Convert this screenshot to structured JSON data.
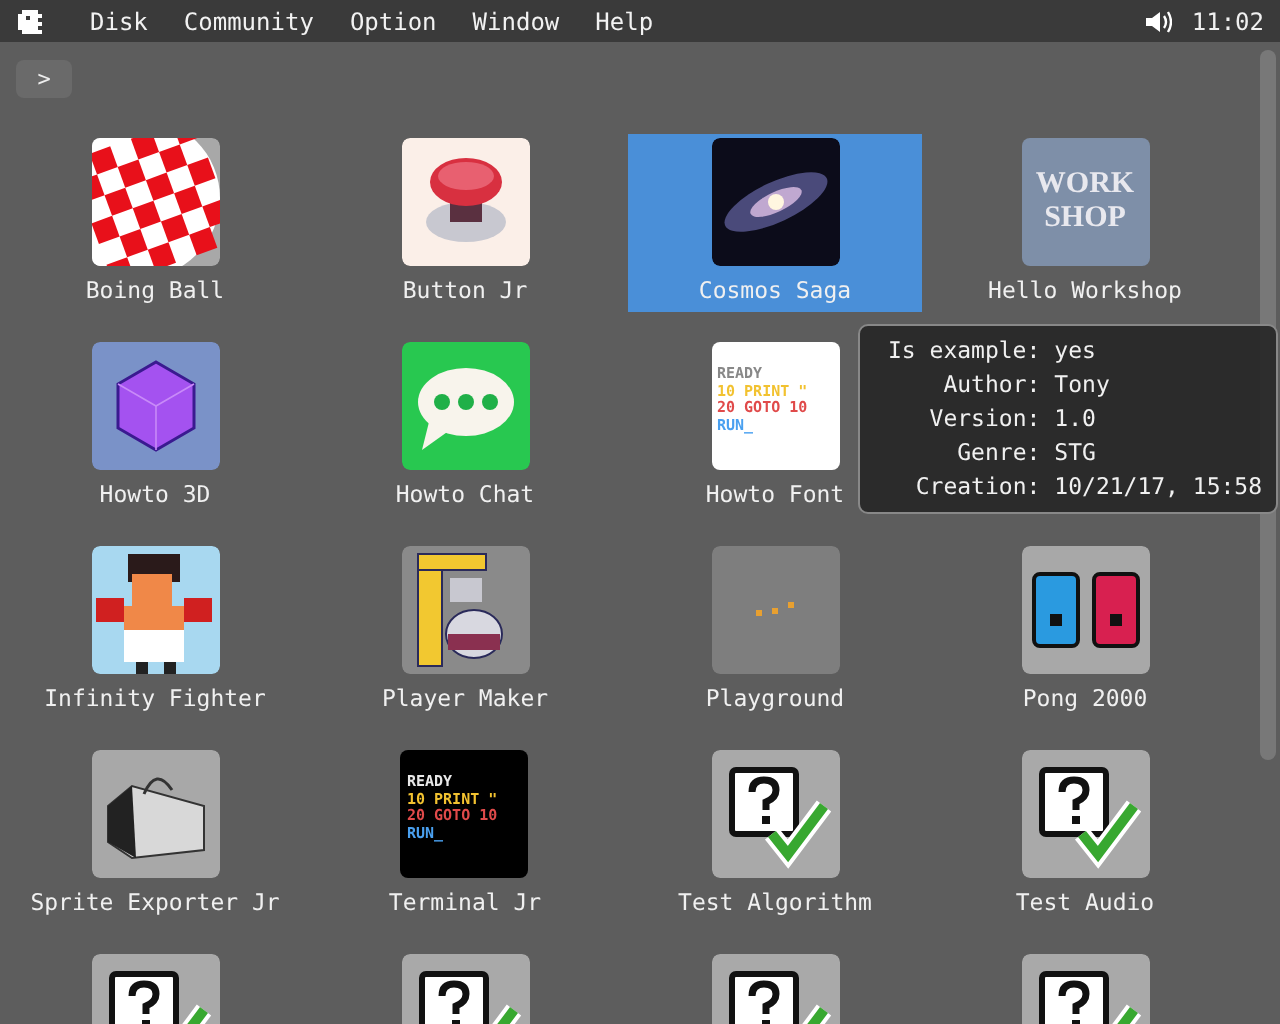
{
  "menu_bar": {
    "items": [
      "Disk",
      "Community",
      "Option",
      "Window",
      "Help"
    ],
    "clock": "11:02"
  },
  "breadcrumb": {
    "label": ">"
  },
  "programs": [
    {
      "label": "Boing Ball",
      "kind": "ball",
      "selected": false
    },
    {
      "label": "Button Jr",
      "kind": "button",
      "selected": false
    },
    {
      "label": "Cosmos Saga",
      "kind": "galaxy",
      "selected": true
    },
    {
      "label": "Hello Workshop",
      "kind": "workshop",
      "icon_text": [
        "WORK",
        "SHOP"
      ],
      "selected": false
    },
    {
      "label": "Howto 3D",
      "kind": "cube",
      "selected": false
    },
    {
      "label": "Howto Chat",
      "kind": "chat",
      "selected": false
    },
    {
      "label": "Howto Font",
      "kind": "code",
      "icon_text": [
        "READY",
        "10 PRINT \"",
        "20 GOTO 10",
        "RUN_"
      ],
      "selected": false
    },
    {
      "kind": "hidden"
    },
    {
      "label": "Infinity Fighter",
      "kind": "fighter",
      "selected": false
    },
    {
      "label": "Player Maker",
      "kind": "coffee",
      "selected": false
    },
    {
      "label": "Playground",
      "kind": "playground",
      "selected": false
    },
    {
      "label": "Pong 2000",
      "kind": "pong",
      "selected": false
    },
    {
      "label": "Sprite Exporter Jr",
      "kind": "toolbox",
      "selected": false
    },
    {
      "label": "Terminal Jr",
      "kind": "terminal",
      "icon_text": [
        "READY",
        "10 PRINT \"",
        "20 GOTO 10",
        "RUN_"
      ],
      "selected": false
    },
    {
      "label": "Test Algorithm",
      "kind": "test",
      "selected": false
    },
    {
      "label": "Test Audio",
      "kind": "test",
      "selected": false
    },
    {
      "kind": "test",
      "selected": false
    },
    {
      "kind": "test",
      "selected": false
    },
    {
      "kind": "test",
      "selected": false
    },
    {
      "kind": "test",
      "selected": false
    }
  ],
  "tooltip": {
    "rows": [
      {
        "key": "Is example:",
        "value": "yes"
      },
      {
        "key": "Author:",
        "value": "Tony"
      },
      {
        "key": "Version:",
        "value": "1.0"
      },
      {
        "key": "Genre:",
        "value": "STG"
      },
      {
        "key": "Creation:",
        "value": "10/21/17, 15:58"
      }
    ]
  }
}
